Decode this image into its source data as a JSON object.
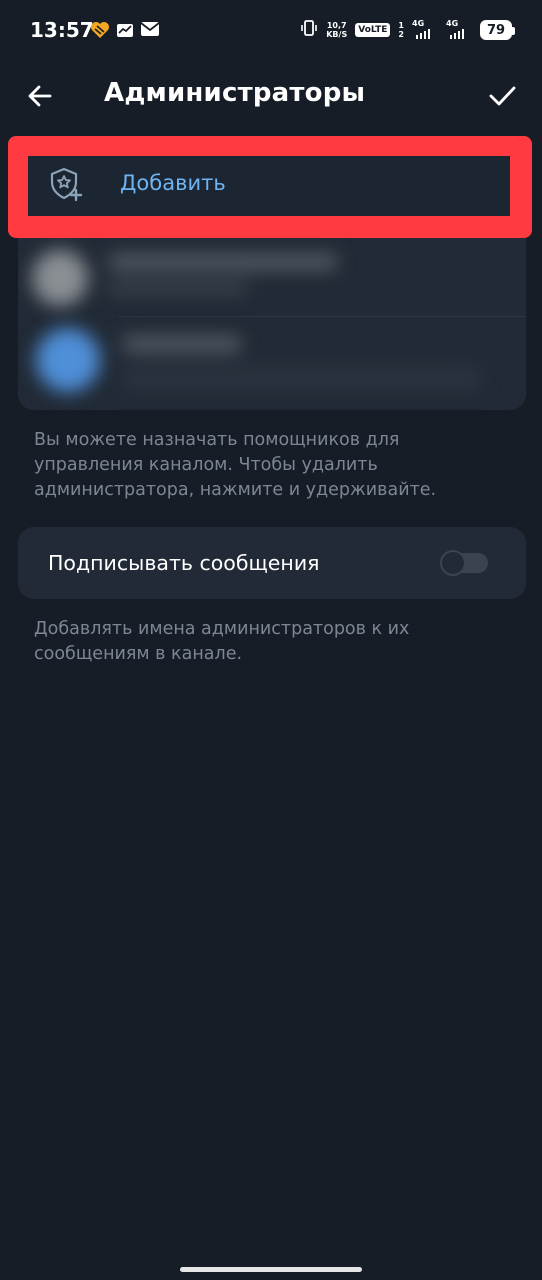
{
  "status_bar": {
    "time": "13:57",
    "speed_value": "10,7",
    "speed_unit": "KB/S",
    "volte": "VoLTE",
    "sim1": "1",
    "sim2": "2",
    "net1": "4G",
    "net2": "4G",
    "battery": "79"
  },
  "app_bar": {
    "title": "Администраторы"
  },
  "add_admin": {
    "label": "Добавить",
    "icon": "shield-star-plus-icon"
  },
  "admins_hint": "Вы можете назначать помощников для управления каналом. Чтобы удалить администратора, нажмите и удерживайте.",
  "sign_messages": {
    "label": "Подписывать сообщения",
    "enabled": false
  },
  "sign_hint": "Добавлять имена администраторов к их сообщениям в канале.",
  "colors": {
    "background": "#171d27",
    "card": "#212a36",
    "accent": "#6fb4f2",
    "highlight": "#ff3a40",
    "hint_text": "#7b8794"
  }
}
